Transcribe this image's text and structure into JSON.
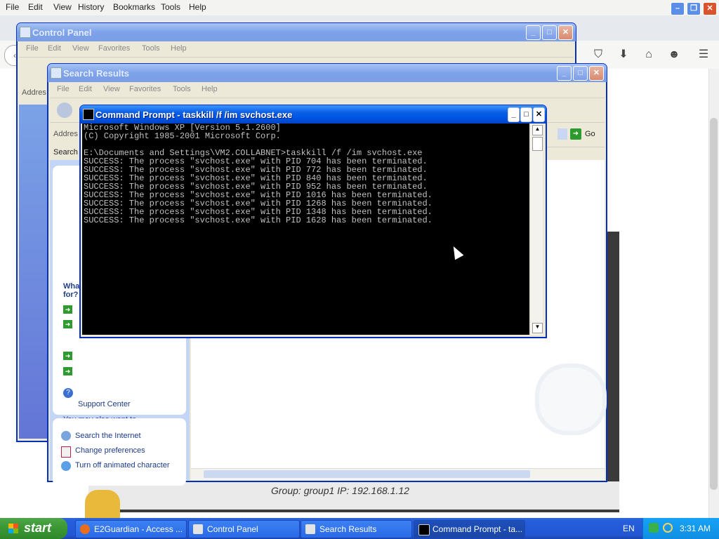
{
  "browser": {
    "menu": [
      "File",
      "Edit",
      "View",
      "History",
      "Bookmarks",
      "Tools",
      "Help"
    ]
  },
  "control_panel": {
    "title": "Control Panel",
    "menu": [
      "File",
      "Edit",
      "View",
      "Favorites",
      "Tools",
      "Help"
    ],
    "address_label": "Addres"
  },
  "search_results": {
    "title": "Search Results",
    "menu": [
      "File",
      "Edit",
      "View",
      "Favorites",
      "Tools",
      "Help"
    ],
    "address_label": "Addres",
    "go_label": "Go",
    "search_label": "Search",
    "what_label": "Wha",
    "for_label": "for?",
    "support_center": "Support Center",
    "also_want": "You may also want to...",
    "links": [
      "Search the Internet",
      "Change preferences",
      "Turn off animated character"
    ],
    "group_text": "Group: group1   IP: 192.168.1.12"
  },
  "cmd": {
    "title": "Command Prompt - taskkill /f /im svchost.exe",
    "lines": [
      "Microsoft Windows XP [Version 5.1.2600]",
      "(C) Copyright 1985-2001 Microsoft Corp.",
      "",
      "E:\\Documents and Settings\\VM2.COLLABNET>taskkill /f /im svchost.exe",
      "SUCCESS: The process \"svchost.exe\" with PID 704 has been terminated.",
      "SUCCESS: The process \"svchost.exe\" with PID 772 has been terminated.",
      "SUCCESS: The process \"svchost.exe\" with PID 840 has been terminated.",
      "SUCCESS: The process \"svchost.exe\" with PID 952 has been terminated.",
      "SUCCESS: The process \"svchost.exe\" with PID 1016 has been terminated.",
      "SUCCESS: The process \"svchost.exe\" with PID 1268 has been terminated.",
      "SUCCESS: The process \"svchost.exe\" with PID 1348 has been terminated.",
      "SUCCESS: The process \"svchost.exe\" with PID 1628 has been terminated."
    ]
  },
  "taskbar": {
    "start": "start",
    "tasks": [
      "E2Guardian - Access ...",
      "Control Panel",
      "Search Results",
      "Command Prompt - ta..."
    ],
    "lang": "EN",
    "clock": "3:31 AM"
  },
  "colors": {
    "xp_blue": "#0054e3",
    "start_green": "#3c9a36",
    "taskbar": "#245edb"
  }
}
